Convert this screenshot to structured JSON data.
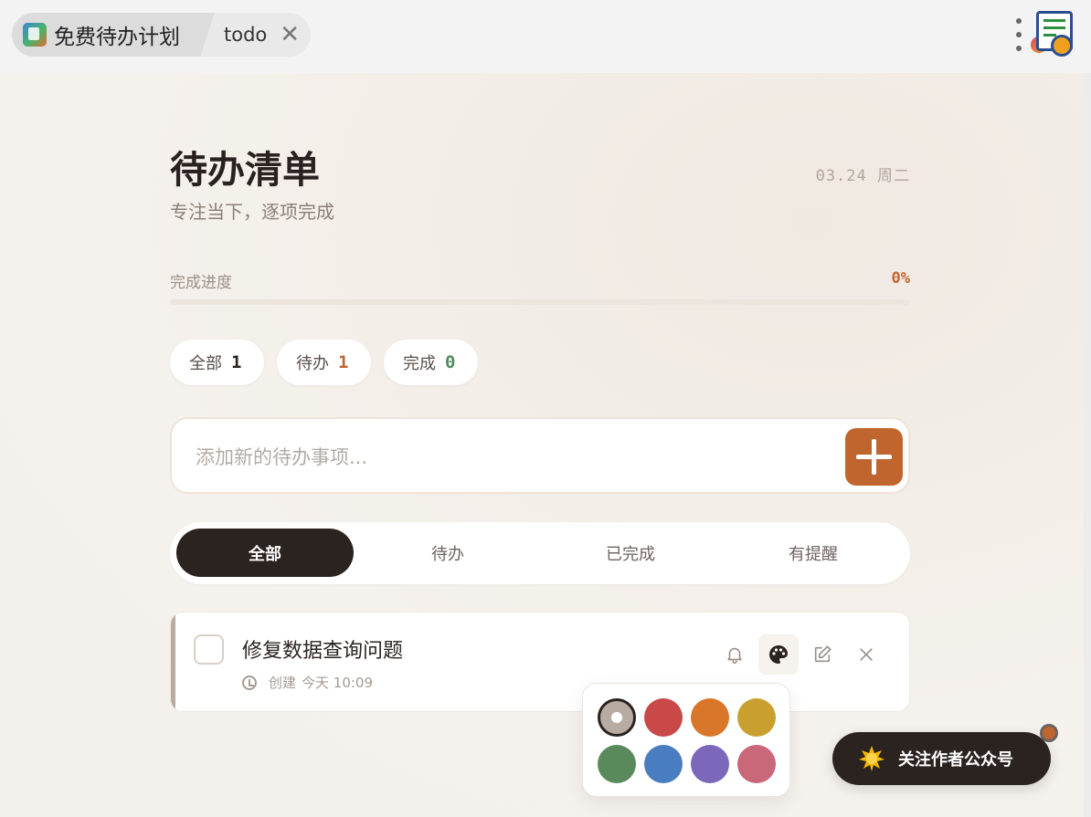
{
  "tabs": {
    "app_label": "免费待办计划",
    "todo_label": "todo",
    "close_glyph": "✕",
    "app_icon": "checklist-app-icon"
  },
  "header": {
    "title": "待办清单",
    "subtitle": "专注当下，逐项完成",
    "date": "03.24 周二"
  },
  "progress": {
    "label": "完成进度",
    "value_text": "0%",
    "fraction": 0
  },
  "stats": [
    {
      "label": "全部",
      "count": "1",
      "color": "#2b2320"
    },
    {
      "label": "待办",
      "count": "1",
      "color": "#c0652e"
    },
    {
      "label": "完成",
      "count": "0",
      "color": "#4f8a5b"
    }
  ],
  "add": {
    "placeholder": "添加新的待办事项..."
  },
  "filters": [
    {
      "label": "全部",
      "active": true
    },
    {
      "label": "待办",
      "active": false
    },
    {
      "label": "已完成",
      "active": false
    },
    {
      "label": "有提醒",
      "active": false
    }
  ],
  "tasks": [
    {
      "title": "修复数据查询问题",
      "created_label": "创建",
      "created_time": "今天 10:09",
      "completed": false,
      "accent_color": "#b8aca2"
    }
  ],
  "task_actions": [
    "bell-icon",
    "palette-icon",
    "edit-icon",
    "close-icon"
  ],
  "palette": {
    "colors": [
      "#b8aca2",
      "#c94848",
      "#d8772a",
      "#c9a030",
      "#5a8a5c",
      "#4a7cc0",
      "#7b68bb",
      "#c96878"
    ],
    "selected_index": 0
  },
  "follow": {
    "label": "关注作者公众号",
    "icon": "sun-icon"
  }
}
